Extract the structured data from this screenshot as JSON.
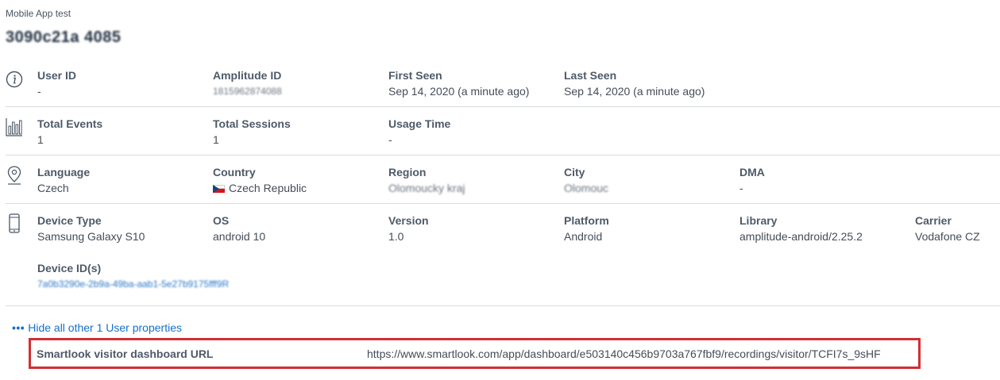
{
  "header": {
    "breadcrumb": "Mobile App test",
    "user_title": "3090c21a 4085"
  },
  "rows": [
    {
      "icon": "info-icon",
      "fields": [
        {
          "label": "User ID",
          "value": "-"
        },
        {
          "label": "Amplitude ID",
          "value": "1815962874088",
          "redacted": true
        },
        {
          "label": "First Seen",
          "value": "Sep 14, 2020 (a minute ago)"
        },
        {
          "label": "Last Seen",
          "value": "Sep 14, 2020 (a minute ago)"
        }
      ]
    },
    {
      "icon": "bar-chart-icon",
      "fields": [
        {
          "label": "Total Events",
          "value": "1"
        },
        {
          "label": "Total Sessions",
          "value": "1"
        },
        {
          "label": "Usage Time",
          "value": "-"
        }
      ]
    },
    {
      "icon": "location-pin-icon",
      "fields": [
        {
          "label": "Language",
          "value": "Czech"
        },
        {
          "label": "Country",
          "value": "Czech Republic"
        },
        {
          "label": "Region",
          "value": "Olomoucky kraj",
          "redacted": true
        },
        {
          "label": "City",
          "value": "Olomouc",
          "redacted": true
        },
        {
          "label": "DMA",
          "value": "-"
        }
      ]
    },
    {
      "icon": "mobile-device-icon",
      "fields": [
        {
          "label": "Device Type",
          "value": "Samsung Galaxy S10"
        },
        {
          "label": "OS",
          "value": "android 10"
        },
        {
          "label": "Version",
          "value": "1.0"
        },
        {
          "label": "Platform",
          "value": "Android"
        },
        {
          "label": "Library",
          "value": "amplitude-android/2.25.2"
        },
        {
          "label": "Carrier",
          "value": "Vodafone CZ"
        }
      ],
      "device_ids": {
        "label": "Device ID(s)",
        "value": "7a0b3290e-2b9a-49ba-aab1-5e27b9175fff9R",
        "redacted": true
      }
    }
  ],
  "toggle": {
    "dots": "•••",
    "label": "Hide all other 1 User properties"
  },
  "user_property": {
    "label": "Smartlook visitor dashboard URL",
    "value": "https://www.smartlook.com/app/dashboard/e503140c456b9703a767fbf9/recordings/visitor/TCFI7s_9sHF"
  },
  "colors": {
    "link": "#1670c9",
    "highlight_border": "#d42e34",
    "divider": "#d8dde3"
  }
}
